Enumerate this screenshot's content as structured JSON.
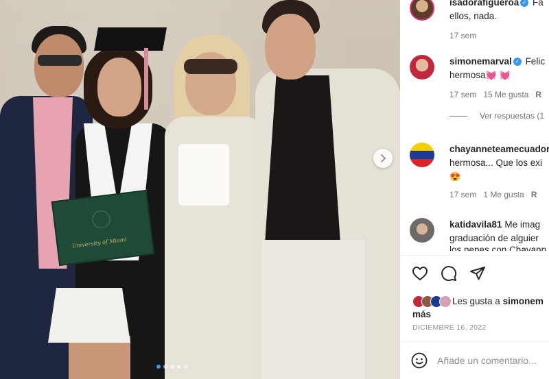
{
  "photo": {
    "diploma_text": "University of Miami",
    "carousel_dots": 5,
    "carousel_active_index": 0
  },
  "comments": [
    {
      "username": "isadorafigueroa",
      "verified": true,
      "text_start": "Fa",
      "text_line2": "ellos, nada.",
      "time": "17 sem",
      "likes": "",
      "reply": ""
    },
    {
      "username": "simonemarval",
      "verified": true,
      "text_start": "Felic",
      "text_line2": "hermosa",
      "time": "17 sem",
      "likes": "15 Me gusta",
      "reply": "R"
    },
    {
      "username": "chayanneteamecuador",
      "verified": false,
      "text_start": "",
      "text_line2": "hermosa... Que los exi",
      "time": "17 sem",
      "likes": "1 Me gusta",
      "reply": "R"
    },
    {
      "username": "katidavila81",
      "verified": false,
      "text_start": "Me imag",
      "text_line2": "graduación de alguier",
      "text_line3": "los nenes con Chayann",
      "time": "",
      "likes": "",
      "reply": ""
    }
  ],
  "view_replies": "Ver respuestas (1",
  "actions": {
    "like": "heart-icon",
    "comment": "comment-icon",
    "share": "share-icon"
  },
  "likes": {
    "prefix": "Les gusta a ",
    "user": "simonem",
    "suffix": "más"
  },
  "post_date": "DICIEMBRE 16, 2022",
  "add_comment": {
    "placeholder": "Añade un comentario..."
  },
  "colors": {
    "link_blue": "#3897f0",
    "heart_red": "#e0245e",
    "meta_gray": "#737373"
  }
}
